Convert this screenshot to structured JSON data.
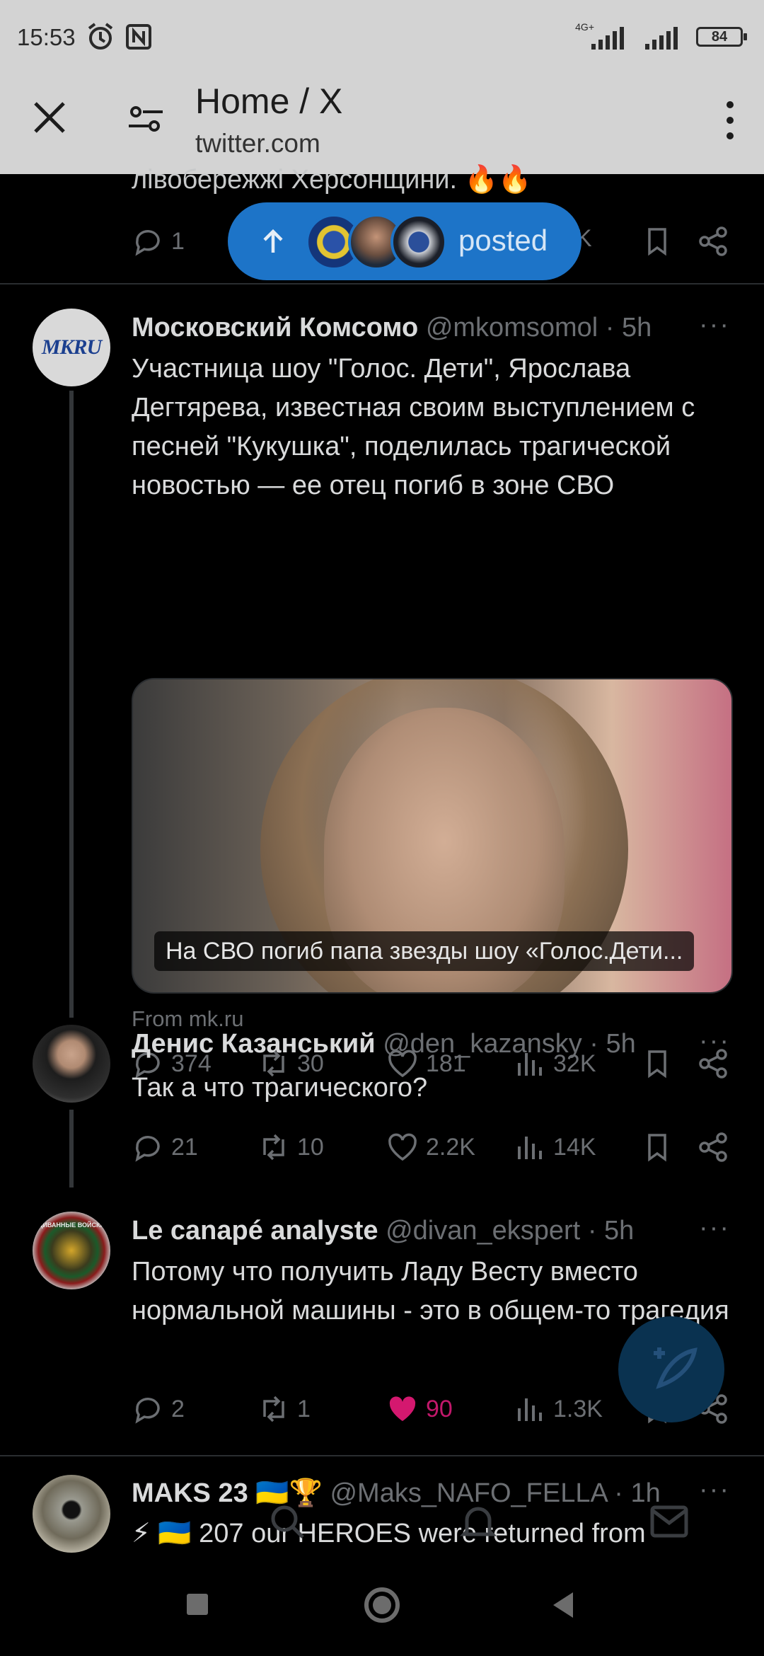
{
  "status_bar": {
    "time": "15:53",
    "network_label": "4G+",
    "battery": "84"
  },
  "browser": {
    "title": "Home / X",
    "url": "twitter.com"
  },
  "previous_tweet": {
    "text_fragment": "лівобережжі Херсонщини. 🔥🔥",
    "replies": "1",
    "views_fragment": "K"
  },
  "posted_pill": {
    "label": "posted"
  },
  "tweets": [
    {
      "name": "Московский Комсомо",
      "handle": "@mkomsomol",
      "time": "· 5h",
      "avatar_text": "MKRU",
      "text": "Участница шоу \"Голос. Дети\", Ярослава Дегтярева, известная своим выступлением с песней \"Кукушка\", поделилась трагической новостью — ее отец погиб в зоне СВО",
      "card_caption": "На СВО погиб папа звезды шоу «Голос.Дети...",
      "from": "From mk.ru",
      "replies": "374",
      "retweets": "30",
      "likes": "181",
      "views": "32K"
    },
    {
      "name": "Денис Казанський",
      "handle": "@den_kazansky",
      "time": "· 5h",
      "text": "Так а что трагического?",
      "replies": "21",
      "retweets": "10",
      "likes": "2.2K",
      "views": "14K"
    },
    {
      "name": "Le canapé analyste",
      "handle": "@divan_ekspert",
      "time": "· 5h",
      "avatar_text": "ДИВАННЫЕ ВОЙСКА",
      "text": "Потому что получить Ладу Весту вместо нормальной машины - это в общем-то трагедия",
      "replies": "2",
      "retweets": "1",
      "likes": "90",
      "views": "1.3K"
    },
    {
      "name": "MAKS 23 🇺🇦🏆",
      "handle": "@Maks_NAFO_FELLA",
      "time": "· 1h",
      "text": "⚡ 🇺🇦 207 our HEROES  were returned from"
    }
  ],
  "more_label": "···",
  "colors": {
    "like_active": "#f91880",
    "pill": "#1d74c8",
    "link": "#1d9bf0"
  }
}
